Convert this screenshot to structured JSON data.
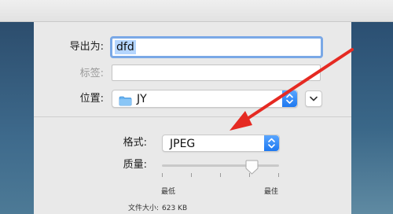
{
  "dialog": {
    "export_as_label": "导出为:",
    "export_as_value": "dfd",
    "tags_label": "标签:",
    "tags_value": "",
    "location_label": "位置:",
    "location_value": "JY",
    "format_label": "格式:",
    "format_value": "JPEG",
    "quality_label": "质量:",
    "quality_level": 0.77,
    "quality_min_label": "最低",
    "quality_max_label": "最佳",
    "file_size_label": "文件大小:",
    "file_size_value": "623 KB"
  },
  "colors": {
    "accent_blue": "#1d78f0",
    "focus_ring": "#7aa8e6",
    "annotation_arrow": "#e52a22"
  }
}
